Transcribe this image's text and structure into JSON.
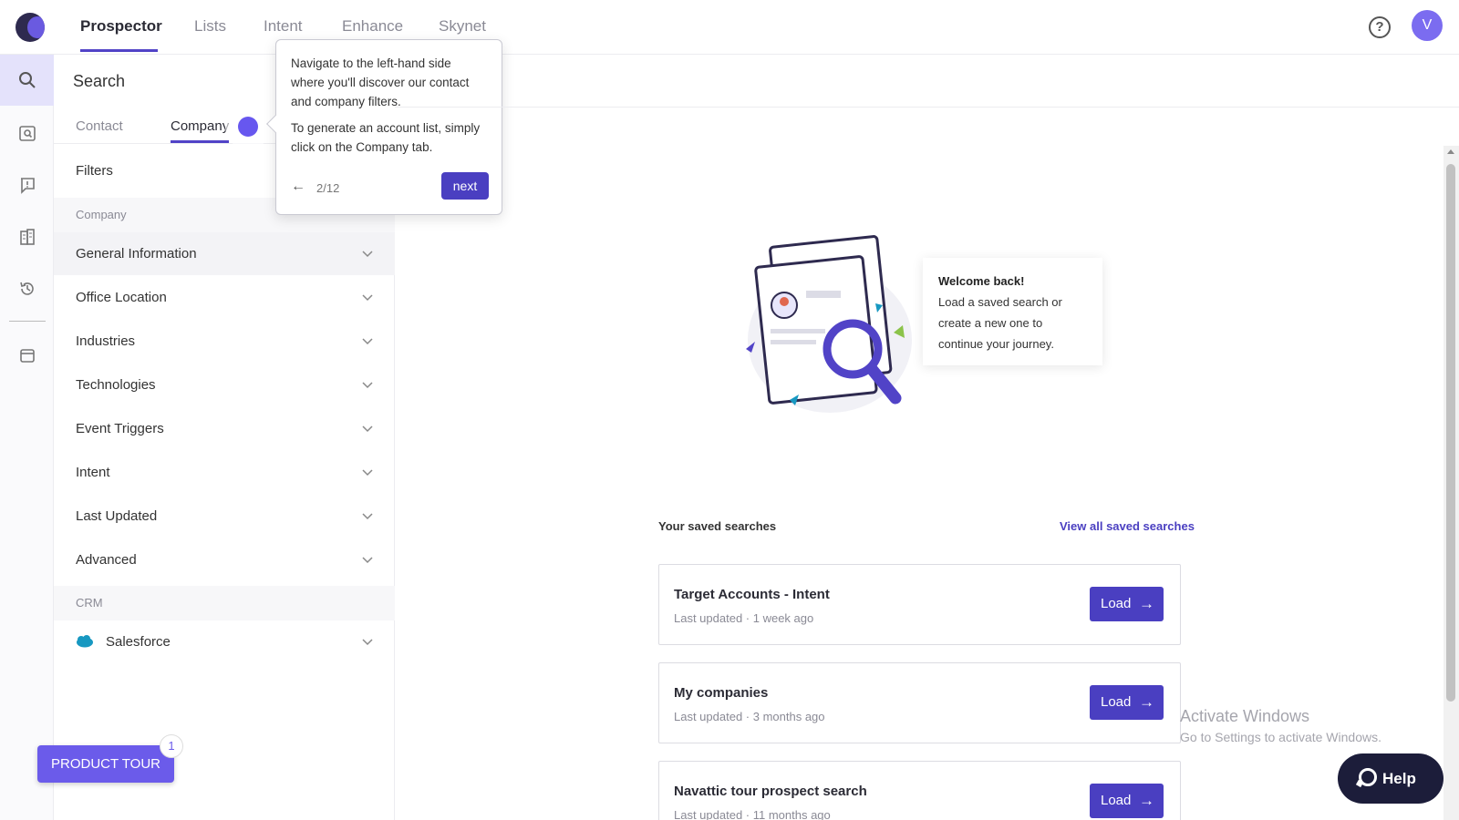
{
  "topnav": {
    "tabs": [
      {
        "label": "Prospector",
        "active": true
      },
      {
        "label": "Lists",
        "active": false
      },
      {
        "label": "Intent",
        "active": false
      },
      {
        "label": "Enhance",
        "active": false
      },
      {
        "label": "Skynet",
        "active": false
      }
    ],
    "help_icon": "?",
    "avatar_initial": "V"
  },
  "rail": {
    "icons": [
      "search-icon",
      "company-search-icon",
      "alert-icon",
      "building-icon",
      "history-icon",
      "wallet-icon"
    ]
  },
  "panel": {
    "title": "Search",
    "tabs": [
      {
        "label": "Contact",
        "active": false
      },
      {
        "label": "Company",
        "active": true
      }
    ],
    "filters_title": "Filters",
    "sections": [
      {
        "header": "Company",
        "items": [
          "General Information",
          "Office Location",
          "Industries",
          "Technologies",
          "Event Triggers",
          "Intent",
          "Last Updated",
          "Advanced"
        ]
      },
      {
        "header": "CRM",
        "items": [
          "Salesforce"
        ]
      }
    ],
    "product_tour_label": "PRODUCT TOUR",
    "product_tour_badge": "1"
  },
  "tooltip": {
    "para1": "Navigate to the left-hand side where you'll discover our contact and company filters.",
    "para2": "To generate an account list, simply click on the Company tab.",
    "back": "←",
    "step": "2/12",
    "next_label": "next"
  },
  "welcome": {
    "title": "Welcome back!",
    "body": "Load a saved search or create a new one to continue your journey."
  },
  "saved": {
    "title": "Your saved searches",
    "view_all": "View all saved searches",
    "cards": [
      {
        "name": "Target Accounts - Intent",
        "meta": "Last updated · 1 week ago",
        "button": "Load"
      },
      {
        "name": "My companies",
        "meta": "Last updated · 3 months ago",
        "button": "Load"
      },
      {
        "name": "Navattic tour prospect search",
        "meta": "Last updated · 11 months ago",
        "button": "Load"
      }
    ]
  },
  "watermark": {
    "title": "Activate Windows",
    "subtitle": "Go to Settings to activate Windows."
  },
  "help_widget": {
    "label": "Help"
  },
  "colors": {
    "brand": "#4a3fc1",
    "brand_light": "#6b5bea",
    "nav_dark": "#1c1d3a"
  }
}
